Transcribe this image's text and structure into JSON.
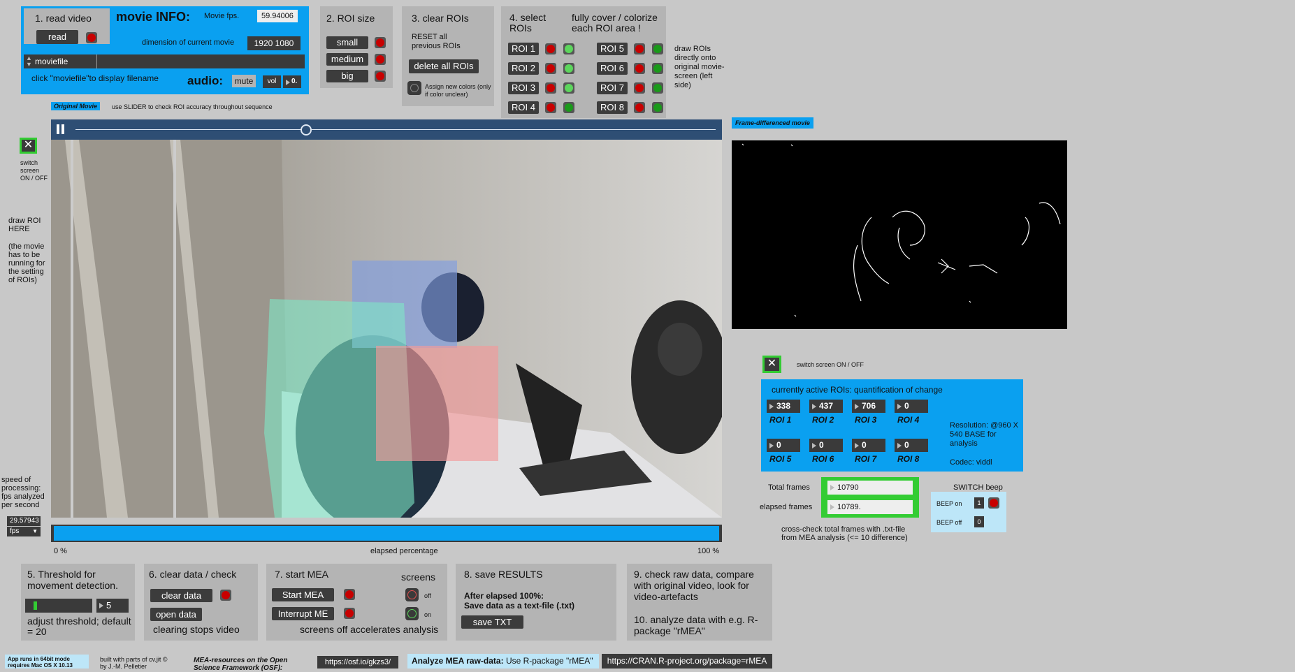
{
  "colors": {
    "accent_blue": "#0aa0f0",
    "panel_grey": "#b4b4b4",
    "led_red": "#c80000",
    "led_green": "#1a9a1a",
    "highlight_green": "#33cc33"
  },
  "read_video": {
    "title": "1. read video",
    "read_button": "read",
    "moviefile_label": "moviefile",
    "hint": "click \"moviefile\"to display  filename"
  },
  "movie_info": {
    "title": "movie INFO:",
    "fps_label": "Movie fps.",
    "fps_value": "59.94006",
    "dimension_label": "dimension of current movie",
    "dimension_value": "1920 1080",
    "audio_label": "audio:",
    "mute_button": "mute",
    "vol_button": "vol",
    "vol_value": "0."
  },
  "roi_size": {
    "title": "2. ROI size",
    "small": "small",
    "medium": "medium",
    "big": "big"
  },
  "clear_rois": {
    "title": "3. clear ROIs",
    "reset_text": "RESET all previous ROIs",
    "delete_button": "delete all ROIs",
    "assign_text": "Assign new colors (only if color unclear)"
  },
  "select_rois": {
    "title": "4. select ROIs",
    "subtitle": "fully cover / colorize each ROI area !",
    "rois": [
      "ROI 1",
      "ROI 2",
      "ROI 3",
      "ROI 4",
      "ROI 5",
      "ROI 6",
      "ROI 7",
      "ROI 8"
    ]
  },
  "draw_rois_note": "draw ROIs directly onto original movie-screen (left side)",
  "original_movie": {
    "badge": "Original Movie",
    "hint": "use SLIDER to check ROI accuracy throughout sequence",
    "playback_fraction": 0.36
  },
  "switch_screen_left": "switch screen ON / OFF",
  "draw_roi_here": "draw ROI HERE",
  "draw_roi_note": "(the movie has to be running for the setting of ROIs)",
  "speed": {
    "label": "speed of processing: fps analyzed per second",
    "value": "29.57943",
    "unit": "fps"
  },
  "elapsed": {
    "left": "0 %",
    "center": "elapsed percentage",
    "right": "100 %",
    "fraction": 0.9999
  },
  "frame_diff": {
    "badge": "Frame-differenced movie",
    "switch_label": "switch screen ON / OFF"
  },
  "active_rois": {
    "title": "currently active ROIs: quantification of change",
    "values": [
      "338",
      "437",
      "706",
      "0",
      "0",
      "0",
      "0",
      "0"
    ],
    "labels": [
      "ROI 1",
      "ROI 2",
      "ROI 3",
      "ROI 4",
      "ROI 5",
      "ROI 6",
      "ROI 7",
      "ROI 8"
    ],
    "resolution": "Resolution: @960 X 540 BASE for analysis",
    "codec": "Codec: viddl"
  },
  "frames": {
    "total_label": "Total frames",
    "total_value": "10790",
    "elapsed_label": "elapsed frames",
    "elapsed_value": "10789.",
    "crosscheck": "cross-check total frames with .txt-file from MEA analysis (<= 10 difference)"
  },
  "beep": {
    "title": "SWITCH beep",
    "on_label": "BEEP  on",
    "on_value": "1",
    "off_label": "BEEP  off",
    "off_value": "0"
  },
  "threshold": {
    "title": "5. Threshold for movement detection.",
    "value": "5",
    "hint": "adjust threshold; default = 20",
    "level_fraction": 0.05
  },
  "clear_data": {
    "title": "6. clear data / check",
    "clear_button": "clear data",
    "open_button": "open data",
    "hint": "clearing stops video"
  },
  "start_mea": {
    "title": "7. start MEA",
    "screens_label": "screens",
    "start_button": "Start MEA",
    "interrupt_button": "Interrupt ME",
    "off_label": "off",
    "on_label": "on",
    "hint": "screens off accelerates analysis"
  },
  "save_results": {
    "title": "8. save RESULTS",
    "text1": "After elapsed 100%:",
    "text2": "Save data as a text-file (.txt)",
    "save_button": "save TXT"
  },
  "check_raw": {
    "title": "9. check raw data, compare with original video, look for video-artefacts",
    "title2": "10. analyze data with e.g. R-package \"rMEA\""
  },
  "footer": {
    "mac_note": "App runs in 64bit  mode requires Mac OS X 10.13",
    "built_note": "built with parts of cv.jit © by J.-M. Pelletier",
    "mea_resources": "MEA-resources on the Open Science Framework (OSF):",
    "osf_link": "https://osf.io/gkzs3/",
    "analyze_label": "Analyze MEA raw-data:",
    "analyze_text": "Use R-package \"rMEA\"",
    "cran_link": "https://CRAN.R-project.org/package=rMEA"
  }
}
